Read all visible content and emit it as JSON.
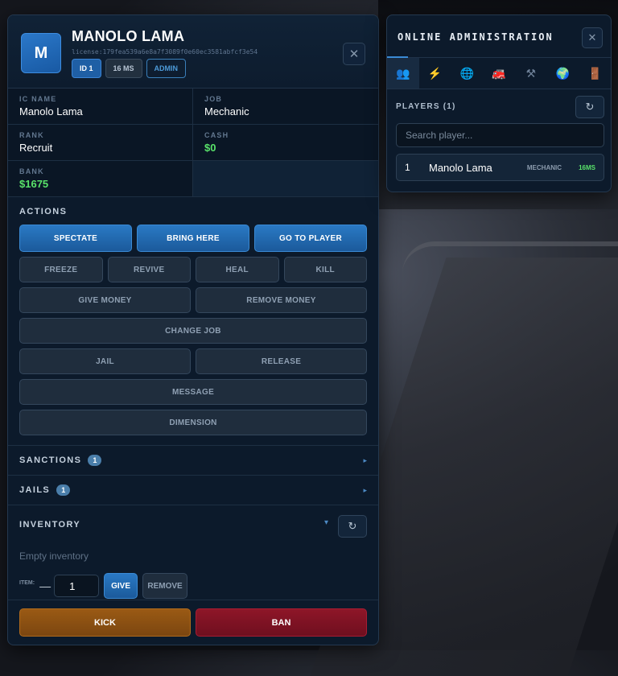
{
  "player": {
    "avatar_letter": "M",
    "name": "MANOLO LAMA",
    "license": "license:179fea539a6e8a7f3089f0e60ec3581abfcf3e54",
    "badges": {
      "id": "ID 1",
      "ping": "16 MS",
      "role": "ADMIN"
    },
    "close": "✕"
  },
  "info": {
    "ic_name_label": "IC NAME",
    "ic_name": "Manolo Lama",
    "job_label": "JOB",
    "job": "Mechanic",
    "rank_label": "RANK",
    "rank": "Recruit",
    "cash_label": "CASH",
    "cash": "$0",
    "bank_label": "BANK",
    "bank": "$1675"
  },
  "actions": {
    "title": "ACTIONS",
    "spectate": "SPECTATE",
    "bring_here": "BRING HERE",
    "go_to_player": "GO TO PLAYER",
    "freeze": "FREEZE",
    "revive": "REVIVE",
    "heal": "HEAL",
    "kill": "KILL",
    "give_money": "GIVE MONEY",
    "remove_money": "REMOVE MONEY",
    "change_job": "CHANGE JOB",
    "jail": "JAIL",
    "release": "RELEASE",
    "message": "MESSAGE",
    "dimension": "DIMENSION"
  },
  "sanctions": {
    "label": "SANCTIONS",
    "count": "1",
    "arrow": "▸"
  },
  "jails": {
    "label": "JAILS",
    "count": "1",
    "arrow": "▸"
  },
  "inventory": {
    "title": "INVENTORY",
    "arrow": "▾",
    "refresh": "↻",
    "empty_text": "Empty inventory",
    "item_label": "ITEM:",
    "minus": "—",
    "quantity": "1",
    "give": "GIVE",
    "remove": "REMOVE"
  },
  "footer": {
    "kick": "KICK",
    "ban": "BAN"
  },
  "admin_panel": {
    "title": "ONLINE ADMINISTRATION",
    "close": "✕",
    "tabs": [
      "👥",
      "⚡",
      "🌐",
      "🚒",
      "⚒",
      "🌍",
      "🚪"
    ],
    "players_label": "PLAYERS (1)",
    "refresh": "↻",
    "search_placeholder": "Search player...",
    "players": [
      {
        "num": "1",
        "name": "Manolo Lama",
        "job": "MECHANIC",
        "ping": "16MS"
      }
    ]
  },
  "colors": {
    "accent": "#2a79c4",
    "money": "#59e36a",
    "kick": "#9a5a14",
    "ban": "#8e1628"
  }
}
